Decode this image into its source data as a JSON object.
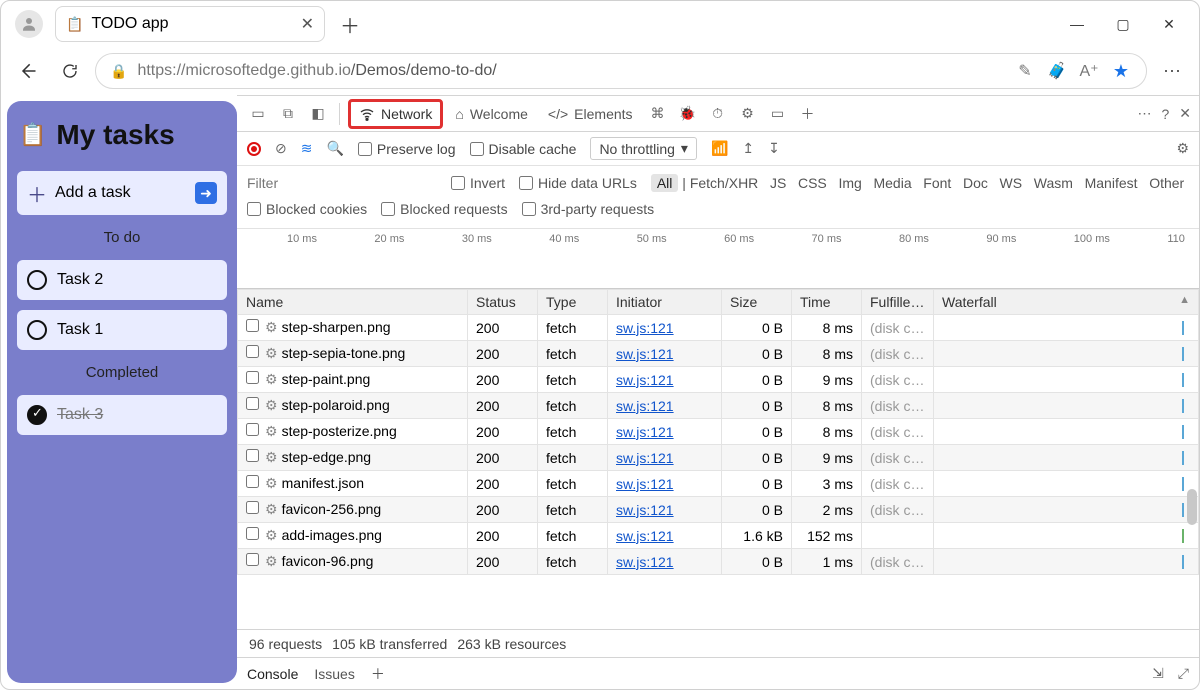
{
  "browser": {
    "tab_title": "TODO app",
    "url_host": "https://microsoftedge.github.io",
    "url_path": "/Demos/demo-to-do/"
  },
  "todo": {
    "title": "My tasks",
    "add_label": "Add a task",
    "sections": {
      "todo": "To do",
      "completed": "Completed"
    },
    "tasks_open": [
      "Task 2",
      "Task 1"
    ],
    "tasks_done": [
      "Task 3"
    ]
  },
  "devtools": {
    "tabs": {
      "network": "Network",
      "welcome": "Welcome",
      "elements": "Elements"
    },
    "toolbar": {
      "preserve_log": "Preserve log",
      "disable_cache": "Disable cache",
      "throttling": "No throttling"
    },
    "filters": {
      "placeholder": "Filter",
      "invert": "Invert",
      "hide_data_urls": "Hide data URLs",
      "types": [
        "All",
        "Fetch/XHR",
        "JS",
        "CSS",
        "Img",
        "Media",
        "Font",
        "Doc",
        "WS",
        "Wasm",
        "Manifest",
        "Other"
      ],
      "blocked_cookies": "Blocked cookies",
      "blocked_requests": "Blocked requests",
      "third_party": "3rd-party requests"
    },
    "timeline_ticks": [
      "10 ms",
      "20 ms",
      "30 ms",
      "40 ms",
      "50 ms",
      "60 ms",
      "70 ms",
      "80 ms",
      "90 ms",
      "100 ms",
      "110"
    ],
    "columns": [
      "Name",
      "Status",
      "Type",
      "Initiator",
      "Size",
      "Time",
      "Fulfilled…",
      "Waterfall"
    ],
    "rows": [
      {
        "name": "step-sharpen.png",
        "status": "200",
        "type": "fetch",
        "initiator": "sw.js:121",
        "size": "0 B",
        "time": "8 ms",
        "fulfilled": "(disk ca…"
      },
      {
        "name": "step-sepia-tone.png",
        "status": "200",
        "type": "fetch",
        "initiator": "sw.js:121",
        "size": "0 B",
        "time": "8 ms",
        "fulfilled": "(disk ca…"
      },
      {
        "name": "step-paint.png",
        "status": "200",
        "type": "fetch",
        "initiator": "sw.js:121",
        "size": "0 B",
        "time": "9 ms",
        "fulfilled": "(disk ca…"
      },
      {
        "name": "step-polaroid.png",
        "status": "200",
        "type": "fetch",
        "initiator": "sw.js:121",
        "size": "0 B",
        "time": "8 ms",
        "fulfilled": "(disk ca…"
      },
      {
        "name": "step-posterize.png",
        "status": "200",
        "type": "fetch",
        "initiator": "sw.js:121",
        "size": "0 B",
        "time": "8 ms",
        "fulfilled": "(disk ca…"
      },
      {
        "name": "step-edge.png",
        "status": "200",
        "type": "fetch",
        "initiator": "sw.js:121",
        "size": "0 B",
        "time": "9 ms",
        "fulfilled": "(disk ca…"
      },
      {
        "name": "manifest.json",
        "status": "200",
        "type": "fetch",
        "initiator": "sw.js:121",
        "size": "0 B",
        "time": "3 ms",
        "fulfilled": "(disk ca…"
      },
      {
        "name": "favicon-256.png",
        "status": "200",
        "type": "fetch",
        "initiator": "sw.js:121",
        "size": "0 B",
        "time": "2 ms",
        "fulfilled": "(disk ca…"
      },
      {
        "name": "add-images.png",
        "status": "200",
        "type": "fetch",
        "initiator": "sw.js:121",
        "size": "1.6 kB",
        "time": "152 ms",
        "fulfilled": ""
      },
      {
        "name": "favicon-96.png",
        "status": "200",
        "type": "fetch",
        "initiator": "sw.js:121",
        "size": "0 B",
        "time": "1 ms",
        "fulfilled": "(disk ca…"
      }
    ],
    "status": {
      "requests": "96 requests",
      "transferred": "105 kB transferred",
      "resources": "263 kB resources"
    },
    "drawer": {
      "console": "Console",
      "issues": "Issues"
    }
  }
}
